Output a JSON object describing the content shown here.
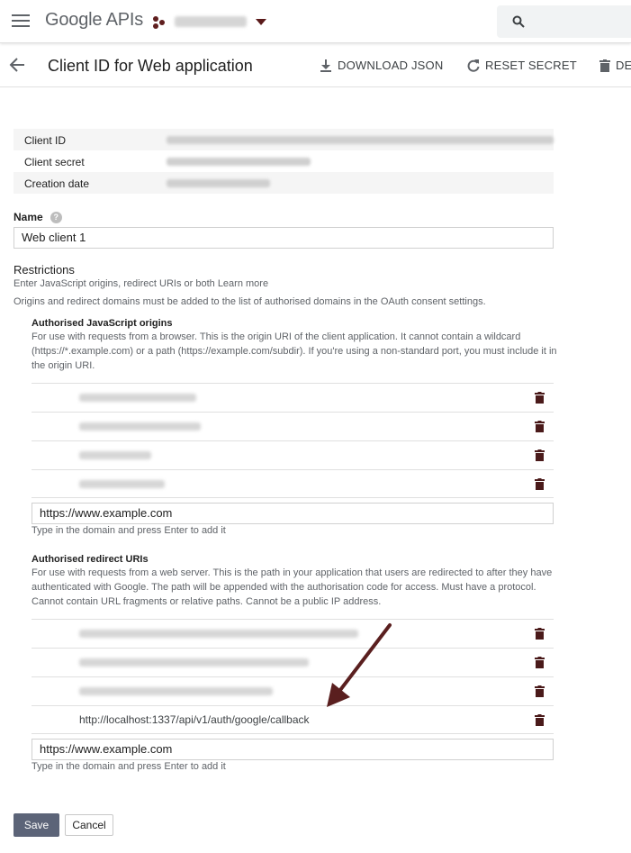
{
  "header": {
    "logo_google": "Google",
    "logo_apis": "APIs"
  },
  "subheader": {
    "title": "Client ID for Web application",
    "download_label": "DOWNLOAD JSON",
    "reset_label": "RESET SECRET",
    "delete_label": "DE"
  },
  "info": {
    "client_id_label": "Client ID",
    "client_secret_label": "Client secret",
    "creation_date_label": "Creation date"
  },
  "name": {
    "label": "Name",
    "help": "?",
    "value": "Web client 1"
  },
  "restrictions": {
    "heading": "Restrictions",
    "line1": "Enter JavaScript origins, redirect URIs or both ",
    "learn_more": "Learn more",
    "line2": "Origins and redirect domains must be added to the list of authorised domains in the OAuth consent settings."
  },
  "js_origins": {
    "title": "Authorised JavaScript origins",
    "description": "For use with requests from a browser. This is the origin URI of the client application. It cannot contain a wildcard (https://*.example.com) or a path (https://example.com/subdir). If you're using a non-standard port, you must include it in the origin URI.",
    "input_value": "https://www.example.com",
    "hint": "Type in the domain and press Enter to add it"
  },
  "redirect_uris": {
    "title": "Authorised redirect URIs",
    "description": "For use with requests from a web server. This is the path in your application that users are redirected to after they have authenticated with Google. The path will be appended with the authorisation code for access. Must have a protocol. Cannot contain URL fragments or relative paths. Cannot be a public IP address.",
    "visible_entry": "http://localhost:1337/api/v1/auth/google/callback",
    "input_value": "https://www.example.com",
    "hint": "Type in the domain and press Enter to add it"
  },
  "footer": {
    "save_label": "Save",
    "cancel_label": "Cancel"
  },
  "colors": {
    "arrow": "#5a1f1f",
    "save_button": "#5c6478",
    "trash_icon": "#4a1a1a"
  }
}
